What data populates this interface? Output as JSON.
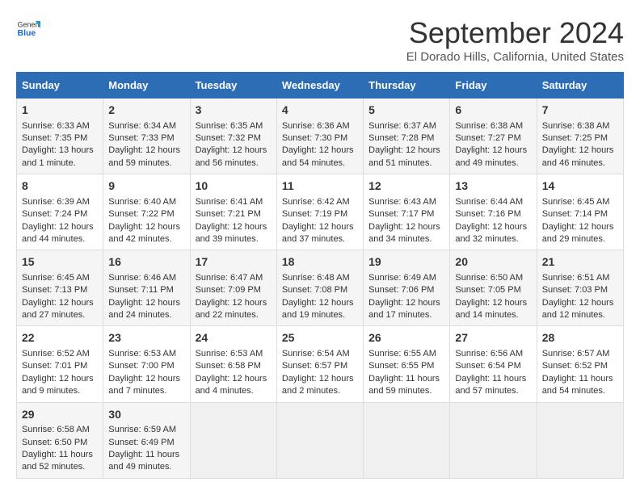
{
  "logo": {
    "general": "General",
    "blue": "Blue"
  },
  "title": "September 2024",
  "location": "El Dorado Hills, California, United States",
  "days_of_week": [
    "Sunday",
    "Monday",
    "Tuesday",
    "Wednesday",
    "Thursday",
    "Friday",
    "Saturday"
  ],
  "weeks": [
    [
      {
        "day": 1,
        "info": "Sunrise: 6:33 AM\nSunset: 7:35 PM\nDaylight: 13 hours\nand 1 minute."
      },
      {
        "day": 2,
        "info": "Sunrise: 6:34 AM\nSunset: 7:33 PM\nDaylight: 12 hours\nand 59 minutes."
      },
      {
        "day": 3,
        "info": "Sunrise: 6:35 AM\nSunset: 7:32 PM\nDaylight: 12 hours\nand 56 minutes."
      },
      {
        "day": 4,
        "info": "Sunrise: 6:36 AM\nSunset: 7:30 PM\nDaylight: 12 hours\nand 54 minutes."
      },
      {
        "day": 5,
        "info": "Sunrise: 6:37 AM\nSunset: 7:28 PM\nDaylight: 12 hours\nand 51 minutes."
      },
      {
        "day": 6,
        "info": "Sunrise: 6:38 AM\nSunset: 7:27 PM\nDaylight: 12 hours\nand 49 minutes."
      },
      {
        "day": 7,
        "info": "Sunrise: 6:38 AM\nSunset: 7:25 PM\nDaylight: 12 hours\nand 46 minutes."
      }
    ],
    [
      {
        "day": 8,
        "info": "Sunrise: 6:39 AM\nSunset: 7:24 PM\nDaylight: 12 hours\nand 44 minutes."
      },
      {
        "day": 9,
        "info": "Sunrise: 6:40 AM\nSunset: 7:22 PM\nDaylight: 12 hours\nand 42 minutes."
      },
      {
        "day": 10,
        "info": "Sunrise: 6:41 AM\nSunset: 7:21 PM\nDaylight: 12 hours\nand 39 minutes."
      },
      {
        "day": 11,
        "info": "Sunrise: 6:42 AM\nSunset: 7:19 PM\nDaylight: 12 hours\nand 37 minutes."
      },
      {
        "day": 12,
        "info": "Sunrise: 6:43 AM\nSunset: 7:17 PM\nDaylight: 12 hours\nand 34 minutes."
      },
      {
        "day": 13,
        "info": "Sunrise: 6:44 AM\nSunset: 7:16 PM\nDaylight: 12 hours\nand 32 minutes."
      },
      {
        "day": 14,
        "info": "Sunrise: 6:45 AM\nSunset: 7:14 PM\nDaylight: 12 hours\nand 29 minutes."
      }
    ],
    [
      {
        "day": 15,
        "info": "Sunrise: 6:45 AM\nSunset: 7:13 PM\nDaylight: 12 hours\nand 27 minutes."
      },
      {
        "day": 16,
        "info": "Sunrise: 6:46 AM\nSunset: 7:11 PM\nDaylight: 12 hours\nand 24 minutes."
      },
      {
        "day": 17,
        "info": "Sunrise: 6:47 AM\nSunset: 7:09 PM\nDaylight: 12 hours\nand 22 minutes."
      },
      {
        "day": 18,
        "info": "Sunrise: 6:48 AM\nSunset: 7:08 PM\nDaylight: 12 hours\nand 19 minutes."
      },
      {
        "day": 19,
        "info": "Sunrise: 6:49 AM\nSunset: 7:06 PM\nDaylight: 12 hours\nand 17 minutes."
      },
      {
        "day": 20,
        "info": "Sunrise: 6:50 AM\nSunset: 7:05 PM\nDaylight: 12 hours\nand 14 minutes."
      },
      {
        "day": 21,
        "info": "Sunrise: 6:51 AM\nSunset: 7:03 PM\nDaylight: 12 hours\nand 12 minutes."
      }
    ],
    [
      {
        "day": 22,
        "info": "Sunrise: 6:52 AM\nSunset: 7:01 PM\nDaylight: 12 hours\nand 9 minutes."
      },
      {
        "day": 23,
        "info": "Sunrise: 6:53 AM\nSunset: 7:00 PM\nDaylight: 12 hours\nand 7 minutes."
      },
      {
        "day": 24,
        "info": "Sunrise: 6:53 AM\nSunset: 6:58 PM\nDaylight: 12 hours\nand 4 minutes."
      },
      {
        "day": 25,
        "info": "Sunrise: 6:54 AM\nSunset: 6:57 PM\nDaylight: 12 hours\nand 2 minutes."
      },
      {
        "day": 26,
        "info": "Sunrise: 6:55 AM\nSunset: 6:55 PM\nDaylight: 11 hours\nand 59 minutes."
      },
      {
        "day": 27,
        "info": "Sunrise: 6:56 AM\nSunset: 6:54 PM\nDaylight: 11 hours\nand 57 minutes."
      },
      {
        "day": 28,
        "info": "Sunrise: 6:57 AM\nSunset: 6:52 PM\nDaylight: 11 hours\nand 54 minutes."
      }
    ],
    [
      {
        "day": 29,
        "info": "Sunrise: 6:58 AM\nSunset: 6:50 PM\nDaylight: 11 hours\nand 52 minutes."
      },
      {
        "day": 30,
        "info": "Sunrise: 6:59 AM\nSunset: 6:49 PM\nDaylight: 11 hours\nand 49 minutes."
      },
      {
        "day": null,
        "info": ""
      },
      {
        "day": null,
        "info": ""
      },
      {
        "day": null,
        "info": ""
      },
      {
        "day": null,
        "info": ""
      },
      {
        "day": null,
        "info": ""
      }
    ]
  ]
}
